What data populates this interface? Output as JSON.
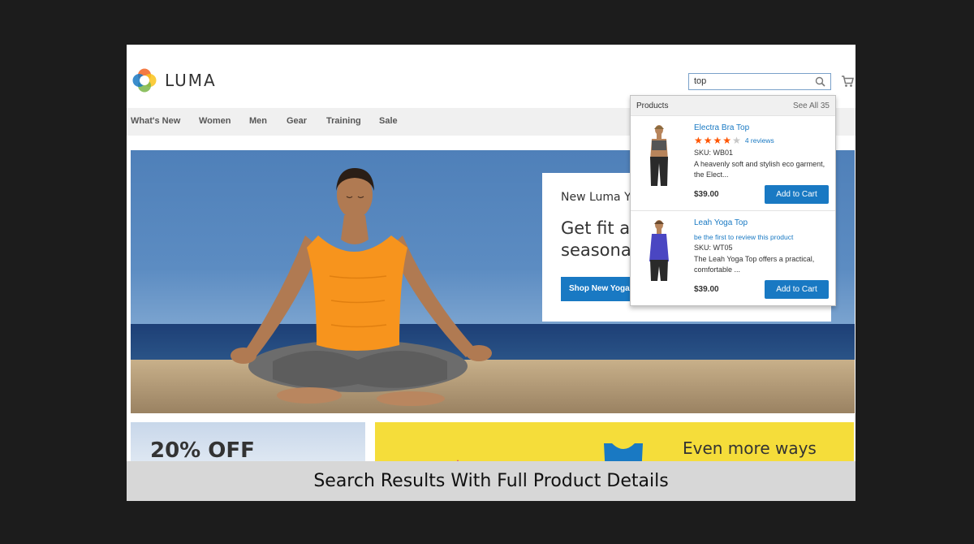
{
  "header": {
    "logo_text": "LUMA",
    "search": {
      "value": "top"
    }
  },
  "nav": {
    "items": [
      "What's New",
      "Women",
      "Men",
      "Gear",
      "Training",
      "Sale"
    ]
  },
  "hero": {
    "eyebrow": "New Luma Y",
    "headline": "Get fit ar seasona",
    "button_label": "Shop New Yoga"
  },
  "search_dropdown": {
    "title": "Products",
    "see_all": "See All 35",
    "products": [
      {
        "name": "Electra Bra Top",
        "rating": 4,
        "rating_max": 5,
        "reviews": "4 reviews",
        "sku": "SKU: WB01",
        "description": "A heavenly soft and stylish eco garment, the Elect...",
        "price": "$39.00",
        "cart_label": "Add to Cart",
        "color": "#555555"
      },
      {
        "name": "Leah Yoga Top",
        "review_prompt": "be the first to review this product",
        "sku": "SKU: WT05",
        "description": "The Leah Yoga Top offers a practical, comfortable ...",
        "price": "$39.00",
        "cart_label": "Add to Cart",
        "color": "#4a46c2"
      }
    ]
  },
  "banners": {
    "left_text": "20% OFF",
    "right_text": "Even more ways"
  },
  "caption": "Search Results With Full Product Details",
  "colors": {
    "accent_blue": "#1979c3",
    "star_orange": "#ff5501",
    "tank_orange": "#f7941d",
    "banner_yellow": "#f5dd3a"
  }
}
